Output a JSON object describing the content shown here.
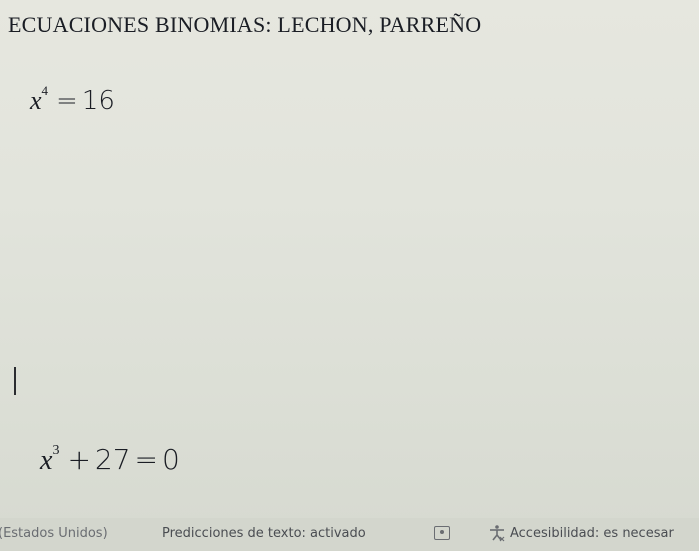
{
  "document": {
    "title": "ECUACIONES BINOMIAS: LECHON, PARREÑO",
    "equations": [
      {
        "variable": "x",
        "exponent": "4",
        "operator": "=",
        "rhs": "16"
      },
      {
        "variable": "x",
        "exponent": "3",
        "operator": "+",
        "term": "27",
        "equals": "=",
        "rhs": "0"
      }
    ]
  },
  "status_bar": {
    "language": "(Estados Unidos)",
    "text_predictions": "Predicciones de texto: activado",
    "focus_icon": "focus-mode-icon",
    "accessibility_icon": "accessibility-icon",
    "accessibility": "Accesibilidad: es necesar"
  }
}
